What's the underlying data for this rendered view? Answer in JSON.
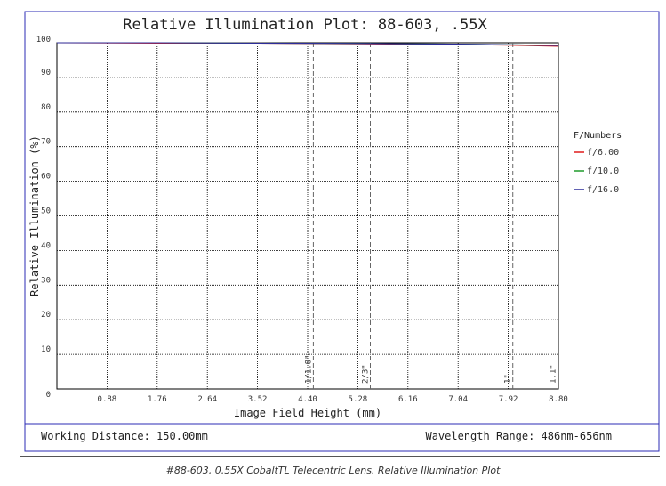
{
  "colors": {
    "frame": "#2b2bb5",
    "grid": "#000000",
    "sensor_lines": "#666666",
    "series_f6": "#e01b1b",
    "series_f10": "#1f9a2a",
    "series_f16": "#2d2d9a"
  },
  "footer": {
    "working_distance": "Working Distance: 150.00mm",
    "wavelength_range": "Wavelength Range: 486nm-656nm"
  },
  "caption": "#88-603, 0.55X CobaltTL Telecentric Lens, Relative Illumination Plot",
  "chart_data": {
    "type": "line",
    "title": "Relative Illumination Plot: 88-603, .55X",
    "xlabel": "Image Field Height (mm)",
    "ylabel": "Relative Illumination (%)",
    "xlim": [
      0,
      8.8
    ],
    "ylim": [
      0,
      100
    ],
    "x_ticks": [
      0.88,
      1.76,
      2.64,
      3.52,
      4.4,
      5.28,
      6.16,
      7.04,
      7.92,
      8.8
    ],
    "x_tick_labels": [
      "0.88",
      "1.76",
      "2.64",
      "3.52",
      "4.40",
      "5.28",
      "6.16",
      "7.04",
      "7.92",
      "8.80"
    ],
    "y_ticks": [
      0,
      10,
      20,
      30,
      40,
      50,
      60,
      70,
      80,
      90,
      100
    ],
    "y_tick_labels": [
      "0",
      "10",
      "20",
      "30",
      "40",
      "50",
      "60",
      "70",
      "80",
      "90",
      "100"
    ],
    "grid": true,
    "legend": {
      "title": "F/Numbers",
      "placement": "right"
    },
    "series": [
      {
        "name": "f/6.00",
        "color": "#e01b1b",
        "x": [
          0,
          1.76,
          3.52,
          5.28,
          7.04,
          7.92,
          8.8
        ],
        "y": [
          100,
          99.9,
          99.9,
          99.7,
          99.5,
          99.3,
          99.0
        ]
      },
      {
        "name": "f/10.0",
        "color": "#1f9a2a",
        "x": [
          0,
          1.76,
          3.52,
          5.28,
          7.04,
          7.92,
          8.8
        ],
        "y": [
          100,
          100,
          99.9,
          99.8,
          99.6,
          99.4,
          99.2
        ]
      },
      {
        "name": "f/16.0",
        "color": "#2d2d9a",
        "x": [
          0,
          1.76,
          3.52,
          5.28,
          7.04,
          7.92,
          8.8
        ],
        "y": [
          100,
          100,
          99.9,
          99.8,
          99.6,
          99.4,
          99.2
        ]
      }
    ],
    "sensor_markers": [
      {
        "label": "1/1.8\"",
        "x": 4.5
      },
      {
        "label": "2/3\"",
        "x": 5.5
      },
      {
        "label": "1\"",
        "x": 8.0
      },
      {
        "label": "1.1\"",
        "x": 8.8
      }
    ]
  }
}
